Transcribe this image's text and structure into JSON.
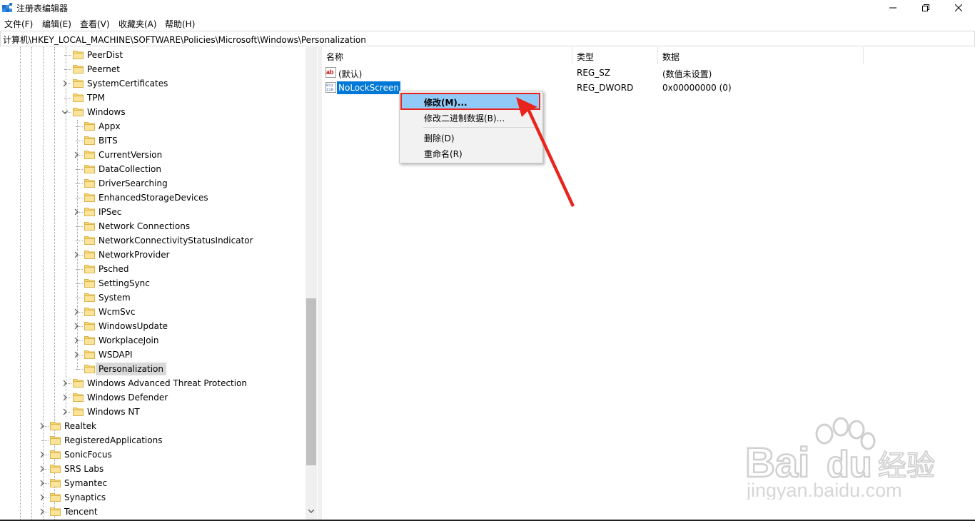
{
  "window": {
    "title": "注册表编辑器",
    "accent": "#0078d7"
  },
  "menu": [
    "文件(F)",
    "编辑(E)",
    "查看(V)",
    "收藏夹(A)",
    "帮助(H)"
  ],
  "address": "计算机\\HKEY_LOCAL_MACHINE\\SOFTWARE\\Policies\\Microsoft\\Windows\\Personalization",
  "tree": {
    "level1": [
      "PeerDist",
      "Peernet",
      "SystemCertificates",
      "TPM",
      "Windows"
    ],
    "windows_children": [
      "Appx",
      "BITS",
      "CurrentVersion",
      "DataCollection",
      "DriverSearching",
      "EnhancedStorageDevices",
      "IPSec",
      "Network Connections",
      "NetworkConnectivityStatusIndicator",
      "NetworkProvider",
      "Psched",
      "SettingSync",
      "System",
      "WcmSvc",
      "WindowsUpdate",
      "WorkplaceJoin",
      "WSDAPI",
      "Personalization"
    ],
    "level1_after": [
      "Windows Advanced Threat Protection",
      "Windows Defender",
      "Windows NT"
    ],
    "level0": [
      "Realtek",
      "RegisteredApplications",
      "SonicFocus",
      "SRS Labs",
      "Symantec",
      "Synaptics",
      "Tencent"
    ],
    "selected": "Personalization"
  },
  "list": {
    "columns": [
      "名称",
      "类型",
      "数据"
    ],
    "rows": [
      {
        "icon": "ab",
        "name": "(默认)",
        "type": "REG_SZ",
        "data": "(数值未设置)"
      },
      {
        "icon": "dword",
        "name": "NoLockScreen",
        "type": "REG_DWORD",
        "data": "0x00000000 (0)"
      }
    ]
  },
  "context_menu": {
    "items": [
      "修改(M)...",
      "修改二进制数据(B)...",
      "删除(D)",
      "重命名(R)"
    ],
    "highlight_color": "#e8241d"
  },
  "watermark": {
    "brand": "Bai",
    "brand2": "du",
    "cn": "经验",
    "url": "jingyan.baidu.com"
  }
}
